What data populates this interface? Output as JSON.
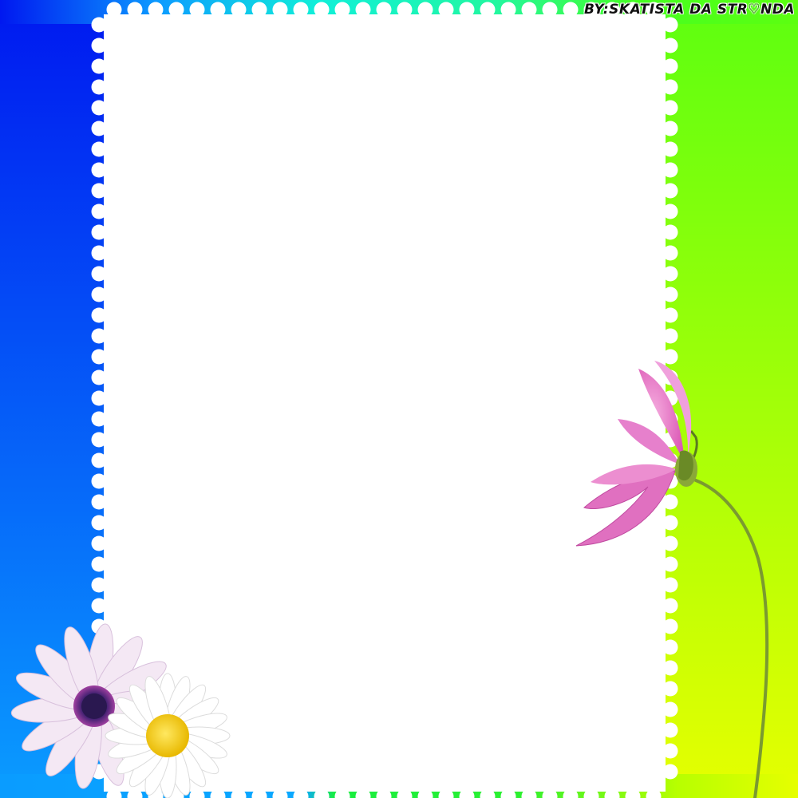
{
  "credit": {
    "text": "BY:SKATISTA DA STR♡NDA"
  },
  "colors": {
    "left_gradient_top": "#0018f0",
    "left_gradient_bottom": "#0a9cff",
    "right_gradient_top": "#5cff10",
    "right_gradient_bottom": "#e6ff00",
    "top_strip_cyan": "#10f0d8",
    "top_strip_green": "#46ff20",
    "bottom_strip_green": "#18ee40",
    "photo_area": "#ffffff",
    "cosmos_petal": "#e878c8",
    "cosmos_petal_light": "#f6b0e0",
    "stem": "#7a9a30",
    "daisy_petal": "#ffffff",
    "daisy_center": "#f5d020",
    "osteospermum_petal": "#f4e8f4",
    "osteospermum_center": "#2a1850"
  },
  "icons": {
    "pink_flower": "cosmos-flower-icon",
    "white_daisy": "daisy-icon",
    "purple_daisy": "osteospermum-icon"
  }
}
